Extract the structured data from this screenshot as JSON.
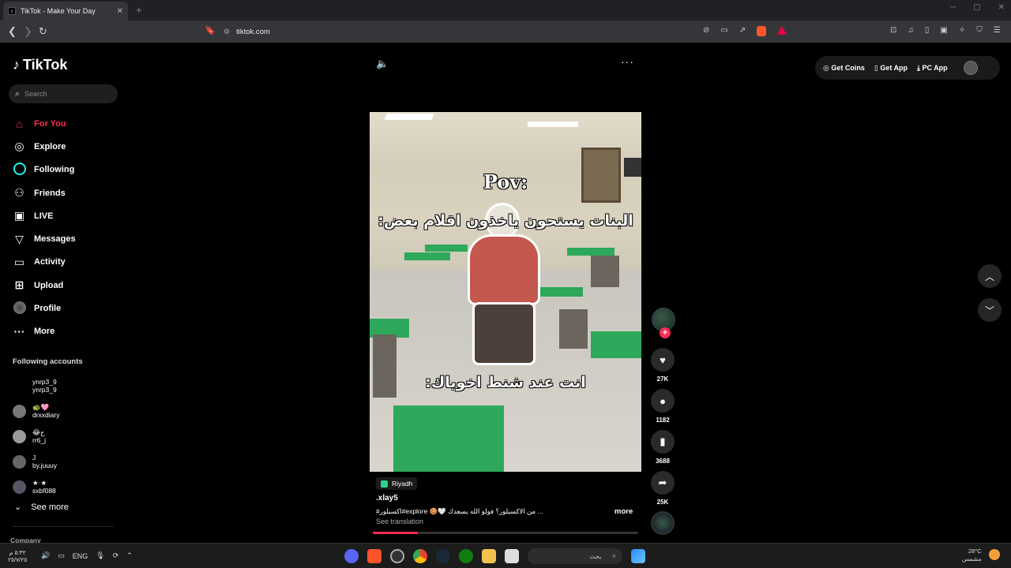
{
  "browser": {
    "tab_title": "TikTok - Make Your Day",
    "tab_close": "✕",
    "new_tab": "+",
    "url": "tiktok.com"
  },
  "sidebar": {
    "logo_text": "TikTok",
    "search_placeholder": "Search",
    "nav": [
      {
        "label": "For You",
        "icon": "home-icon",
        "active": true
      },
      {
        "label": "Explore",
        "icon": "compass-icon"
      },
      {
        "label": "Following",
        "icon": "following-icon"
      },
      {
        "label": "Friends",
        "icon": "friends-icon"
      },
      {
        "label": "LIVE",
        "icon": "live-icon"
      },
      {
        "label": "Messages",
        "icon": "messages-icon"
      },
      {
        "label": "Activity",
        "icon": "activity-icon"
      },
      {
        "label": "Upload",
        "icon": "upload-icon"
      },
      {
        "label": "Profile",
        "icon": "profile-icon"
      },
      {
        "label": "More",
        "icon": "more-icon"
      }
    ],
    "following_header": "Following accounts",
    "following": [
      {
        "name": "ynrp3_9",
        "handle": "ynrp3_9"
      },
      {
        "name": "🐢🩷",
        "handle": "drxxdiary"
      },
      {
        "name": "😂ح",
        "handle": "rr6_j"
      },
      {
        "name": "J",
        "handle": "by.juuuy"
      },
      {
        "name": "★·★",
        "handle": "sxbf088"
      }
    ],
    "see_more": "See more",
    "company": "Company"
  },
  "topbar": {
    "get_coins": "Get Coins",
    "get_app": "Get App",
    "pc_app": "PC App"
  },
  "video": {
    "caption_pov": "Pov:",
    "caption_line1": "البنات يستحون ياخذون اقلام بعض:",
    "caption_line2": "انت عند شنط اخوياك:",
    "location": "Riyadh",
    "username": ".xlay5",
    "description": "#اكسبلور#explore 🍪🤍 من الاكسبلور؟ فولو الله يسعدك ...",
    "more": "more",
    "see_translation": "See translation",
    "progress": 0.17
  },
  "actions": {
    "likes": "27K",
    "comments": "1182",
    "saves": "3688",
    "shares": "25K"
  },
  "taskbar": {
    "time_left": "٥:٣٢ م",
    "date_left": "٢٥/٧/٢٥",
    "lang": "ENG",
    "search": "بحث",
    "weather_temp": "28°C",
    "weather_desc": "مشمس"
  },
  "colors": {
    "accent": "#fe2c55",
    "teal": "#25f4ee",
    "bg": "#000000"
  }
}
